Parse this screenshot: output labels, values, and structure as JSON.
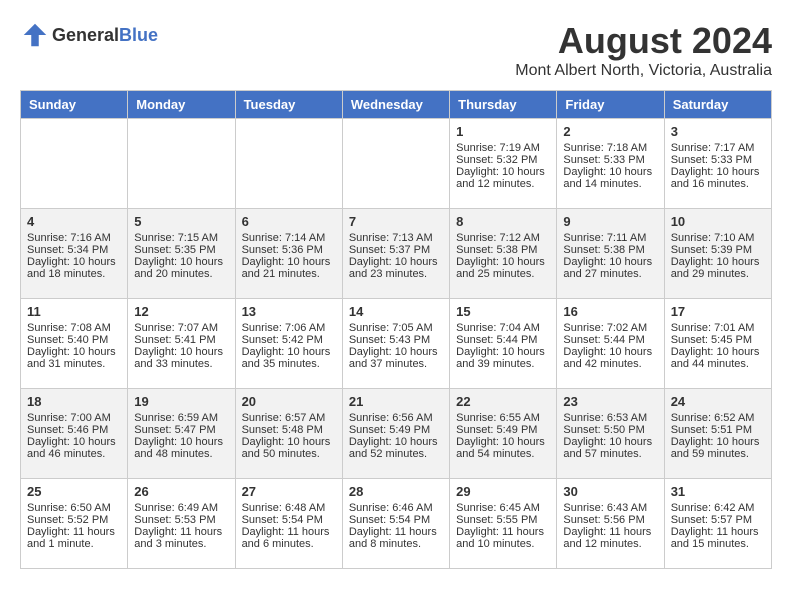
{
  "header": {
    "logo_general": "General",
    "logo_blue": "Blue",
    "month_year": "August 2024",
    "location": "Mont Albert North, Victoria, Australia"
  },
  "days_of_week": [
    "Sunday",
    "Monday",
    "Tuesday",
    "Wednesday",
    "Thursday",
    "Friday",
    "Saturday"
  ],
  "weeks": [
    [
      {
        "day": "",
        "content": ""
      },
      {
        "day": "",
        "content": ""
      },
      {
        "day": "",
        "content": ""
      },
      {
        "day": "",
        "content": ""
      },
      {
        "day": "1",
        "content": "Sunrise: 7:19 AM\nSunset: 5:32 PM\nDaylight: 10 hours\nand 12 minutes."
      },
      {
        "day": "2",
        "content": "Sunrise: 7:18 AM\nSunset: 5:33 PM\nDaylight: 10 hours\nand 14 minutes."
      },
      {
        "day": "3",
        "content": "Sunrise: 7:17 AM\nSunset: 5:33 PM\nDaylight: 10 hours\nand 16 minutes."
      }
    ],
    [
      {
        "day": "4",
        "content": "Sunrise: 7:16 AM\nSunset: 5:34 PM\nDaylight: 10 hours\nand 18 minutes."
      },
      {
        "day": "5",
        "content": "Sunrise: 7:15 AM\nSunset: 5:35 PM\nDaylight: 10 hours\nand 20 minutes."
      },
      {
        "day": "6",
        "content": "Sunrise: 7:14 AM\nSunset: 5:36 PM\nDaylight: 10 hours\nand 21 minutes."
      },
      {
        "day": "7",
        "content": "Sunrise: 7:13 AM\nSunset: 5:37 PM\nDaylight: 10 hours\nand 23 minutes."
      },
      {
        "day": "8",
        "content": "Sunrise: 7:12 AM\nSunset: 5:38 PM\nDaylight: 10 hours\nand 25 minutes."
      },
      {
        "day": "9",
        "content": "Sunrise: 7:11 AM\nSunset: 5:38 PM\nDaylight: 10 hours\nand 27 minutes."
      },
      {
        "day": "10",
        "content": "Sunrise: 7:10 AM\nSunset: 5:39 PM\nDaylight: 10 hours\nand 29 minutes."
      }
    ],
    [
      {
        "day": "11",
        "content": "Sunrise: 7:08 AM\nSunset: 5:40 PM\nDaylight: 10 hours\nand 31 minutes."
      },
      {
        "day": "12",
        "content": "Sunrise: 7:07 AM\nSunset: 5:41 PM\nDaylight: 10 hours\nand 33 minutes."
      },
      {
        "day": "13",
        "content": "Sunrise: 7:06 AM\nSunset: 5:42 PM\nDaylight: 10 hours\nand 35 minutes."
      },
      {
        "day": "14",
        "content": "Sunrise: 7:05 AM\nSunset: 5:43 PM\nDaylight: 10 hours\nand 37 minutes."
      },
      {
        "day": "15",
        "content": "Sunrise: 7:04 AM\nSunset: 5:44 PM\nDaylight: 10 hours\nand 39 minutes."
      },
      {
        "day": "16",
        "content": "Sunrise: 7:02 AM\nSunset: 5:44 PM\nDaylight: 10 hours\nand 42 minutes."
      },
      {
        "day": "17",
        "content": "Sunrise: 7:01 AM\nSunset: 5:45 PM\nDaylight: 10 hours\nand 44 minutes."
      }
    ],
    [
      {
        "day": "18",
        "content": "Sunrise: 7:00 AM\nSunset: 5:46 PM\nDaylight: 10 hours\nand 46 minutes."
      },
      {
        "day": "19",
        "content": "Sunrise: 6:59 AM\nSunset: 5:47 PM\nDaylight: 10 hours\nand 48 minutes."
      },
      {
        "day": "20",
        "content": "Sunrise: 6:57 AM\nSunset: 5:48 PM\nDaylight: 10 hours\nand 50 minutes."
      },
      {
        "day": "21",
        "content": "Sunrise: 6:56 AM\nSunset: 5:49 PM\nDaylight: 10 hours\nand 52 minutes."
      },
      {
        "day": "22",
        "content": "Sunrise: 6:55 AM\nSunset: 5:49 PM\nDaylight: 10 hours\nand 54 minutes."
      },
      {
        "day": "23",
        "content": "Sunrise: 6:53 AM\nSunset: 5:50 PM\nDaylight: 10 hours\nand 57 minutes."
      },
      {
        "day": "24",
        "content": "Sunrise: 6:52 AM\nSunset: 5:51 PM\nDaylight: 10 hours\nand 59 minutes."
      }
    ],
    [
      {
        "day": "25",
        "content": "Sunrise: 6:50 AM\nSunset: 5:52 PM\nDaylight: 11 hours\nand 1 minute."
      },
      {
        "day": "26",
        "content": "Sunrise: 6:49 AM\nSunset: 5:53 PM\nDaylight: 11 hours\nand 3 minutes."
      },
      {
        "day": "27",
        "content": "Sunrise: 6:48 AM\nSunset: 5:54 PM\nDaylight: 11 hours\nand 6 minutes."
      },
      {
        "day": "28",
        "content": "Sunrise: 6:46 AM\nSunset: 5:54 PM\nDaylight: 11 hours\nand 8 minutes."
      },
      {
        "day": "29",
        "content": "Sunrise: 6:45 AM\nSunset: 5:55 PM\nDaylight: 11 hours\nand 10 minutes."
      },
      {
        "day": "30",
        "content": "Sunrise: 6:43 AM\nSunset: 5:56 PM\nDaylight: 11 hours\nand 12 minutes."
      },
      {
        "day": "31",
        "content": "Sunrise: 6:42 AM\nSunset: 5:57 PM\nDaylight: 11 hours\nand 15 minutes."
      }
    ]
  ]
}
